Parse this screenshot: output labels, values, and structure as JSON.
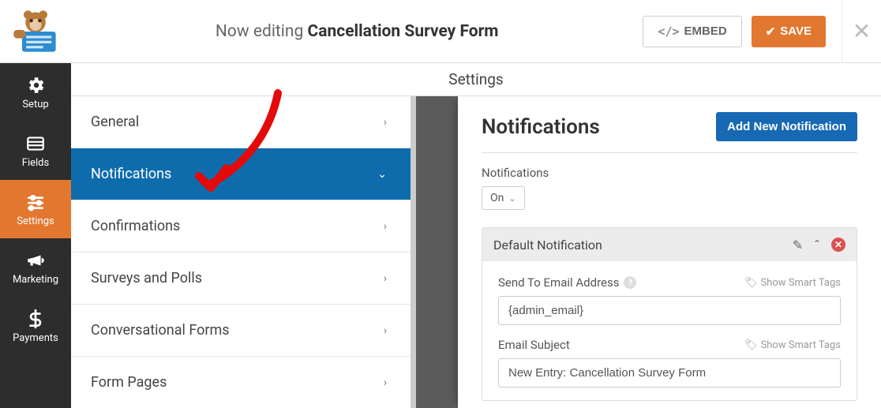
{
  "topbar": {
    "editing_prefix": "Now editing ",
    "form_name": "Cancellation Survey Form",
    "embed_label": "EMBED",
    "save_label": "SAVE"
  },
  "rail": {
    "setup": "Setup",
    "fields": "Fields",
    "settings": "Settings",
    "marketing": "Marketing",
    "payments": "Payments"
  },
  "settings_header": "Settings",
  "subnav": {
    "general": "General",
    "notifications": "Notifications",
    "confirmations": "Confirmations",
    "surveys": "Surveys and Polls",
    "conversational": "Conversational Forms",
    "formpages": "Form Pages"
  },
  "content": {
    "heading": "Notifications",
    "add_btn": "Add New Notification",
    "toggle_label": "Notifications",
    "toggle_value": "On",
    "card_title": "Default Notification",
    "sendto_label": "Send To Email Address",
    "sendto_value": "{admin_email}",
    "subject_label": "Email Subject",
    "subject_value": "New Entry: Cancellation Survey Form",
    "smart_tags": "Show Smart Tags"
  }
}
